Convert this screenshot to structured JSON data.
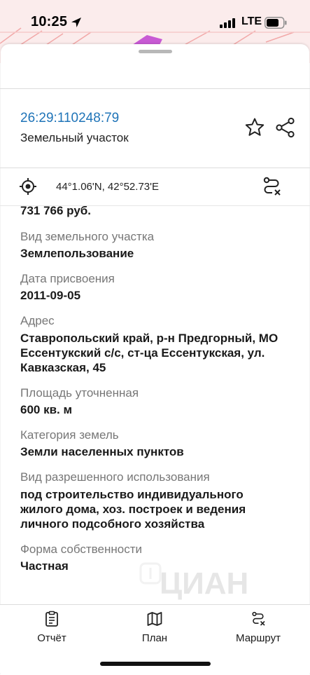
{
  "status_bar": {
    "time": "10:25",
    "network": "LTE"
  },
  "header": {
    "cadastral_number": "26:29:110248:79",
    "object_type": "Земельный участок"
  },
  "location": {
    "coordinates": "44°1.06'N, 42°52.73'E"
  },
  "details": {
    "price_value": "731 766 руб.",
    "items": [
      {
        "label": "Вид земельного участка",
        "value": "Землепользование"
      },
      {
        "label": "Дата присвоения",
        "value": "2011-09-05"
      },
      {
        "label": "Адрес",
        "value": "Ставропольский край, р-н Предгорный, МО Ессентукский с/с, ст-ца Ессентукская, ул. Кавказская, 45"
      },
      {
        "label": "Площадь уточненная",
        "value": "600 кв. м"
      },
      {
        "label": "Категория земель",
        "value": "Земли населенных пунктов"
      },
      {
        "label": "Вид разрешенного использования",
        "value": "под строительство индивидуального жилого дома, хоз. построек и ведения личного подсобного хозяйства"
      },
      {
        "label": "Форма собственности",
        "value": "Частная"
      }
    ]
  },
  "watermark": "ЦИАН",
  "tabbar": {
    "items": [
      {
        "label": "Отчёт",
        "icon": "report-icon"
      },
      {
        "label": "План",
        "icon": "map-icon"
      },
      {
        "label": "Маршрут",
        "icon": "route-icon"
      }
    ]
  },
  "colors": {
    "accent": "#1f74b8",
    "map_background": "#fbecec",
    "label_gray": "#777777"
  }
}
